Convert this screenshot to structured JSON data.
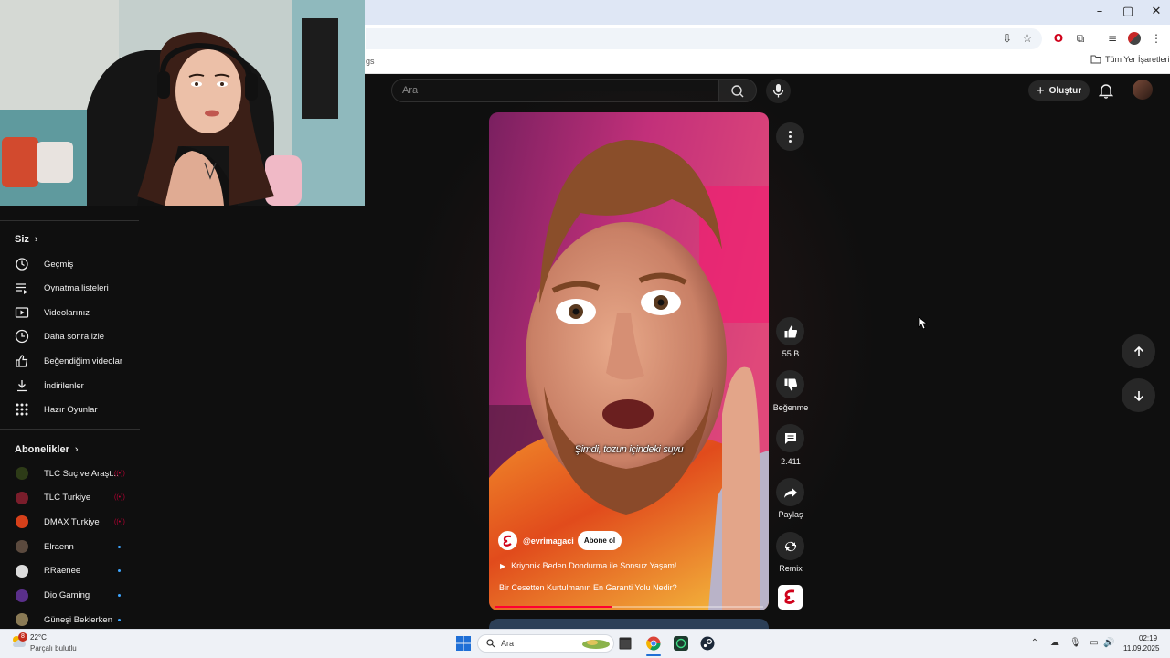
{
  "browser": {
    "bookmark_partial": "gs",
    "all_bookmarks": "Tüm Yer İşaretleri",
    "window_controls": {
      "minimize": "–",
      "restore": "▢",
      "close": "✕"
    }
  },
  "header": {
    "search_placeholder": "Ara",
    "create_label": "Oluştur"
  },
  "sidebar": {
    "you_section": {
      "title": "Siz",
      "items": [
        {
          "label": "Geçmiş",
          "icon": "history-icon"
        },
        {
          "label": "Oynatma listeleri",
          "icon": "playlists-icon"
        },
        {
          "label": "Videolarınız",
          "icon": "your-videos-icon"
        },
        {
          "label": "Daha sonra izle",
          "icon": "watch-later-icon"
        },
        {
          "label": "Beğendiğim videolar",
          "icon": "liked-videos-icon"
        },
        {
          "label": "İndirilenler",
          "icon": "downloads-icon"
        },
        {
          "label": "Hazır Oyunlar",
          "icon": "playables-icon"
        }
      ]
    },
    "subscriptions": {
      "title": "Abonelikler",
      "items": [
        {
          "label": "TLC Suç ve Araşt...",
          "color": "#2d3b17",
          "status": "live"
        },
        {
          "label": "TLC Turkiye",
          "color": "#7a1d2b",
          "status": "live"
        },
        {
          "label": "DMAX Turkiye",
          "color": "#d6401a",
          "status": "live"
        },
        {
          "label": "Elraenn",
          "color": "#5b4a3e",
          "status": "new"
        },
        {
          "label": "RRaenee",
          "color": "#dcdcdc",
          "status": "new"
        },
        {
          "label": "Dio Gaming",
          "color": "#5a2f8a",
          "status": "new"
        },
        {
          "label": "Güneşi Beklerken",
          "color": "#8a7a55",
          "status": "new"
        }
      ]
    }
  },
  "short": {
    "subtitle": "Şimdi, tozun içindeki suyu",
    "channel_handle": "@evrimagaci",
    "subscribe_label": "Abone ol",
    "playlist_title": "Kriyonik Beden Dondurma ile Sonsuz Yaşam!",
    "video_title": "Bir Cesetten Kurtulmanın En Garanti Yolu Nedir?",
    "progress": 0.44,
    "actions": {
      "like_count": "55 B",
      "dislike_label": "Beğenme",
      "comment_count": "2.411",
      "share_label": "Paylaş",
      "remix_label": "Remix"
    }
  },
  "taskbar": {
    "weather_temp": "22°C",
    "weather_desc": "Parçalı bulutlu",
    "weather_badge": "8",
    "search_label": "Ara",
    "time": "02:19",
    "date": "11.09.2025"
  },
  "colors": {
    "accent_red": "#ff0033",
    "background": "#0f0f0f",
    "button_bg": "#272727",
    "new_dot": "#3ea6ff"
  }
}
